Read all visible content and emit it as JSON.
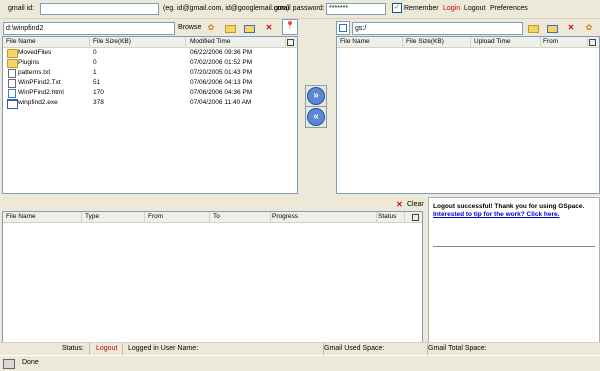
{
  "login": {
    "gmail_id_label": "gmail id:",
    "gmail_id_value": "",
    "gmail_id_hint": "(eg. id@gmail.com, id@googlemail.com)",
    "password_label": "gmail password:",
    "password_value": "*******",
    "remember_label": "Remember",
    "remember_checked": "✓",
    "login_link": "Login",
    "logout_link": "Logout",
    "preferences_link": "Preferences"
  },
  "local": {
    "path": "d:\\winpfind2",
    "browse_label": "Browse",
    "columns": [
      "File Name",
      "File Size(KB)",
      "Modified Time"
    ],
    "files": [
      {
        "name": "MovedFiles",
        "size": "0",
        "time": "06/22/2006 09:36 PM",
        "icon": "folder-icon"
      },
      {
        "name": "Plugins",
        "size": "0",
        "time": "07/02/2006 01:52 PM",
        "icon": "folder-icon"
      },
      {
        "name": "patterns.txt",
        "size": "1",
        "time": "07/20/2005 01:43 PM",
        "icon": "text-file-icon"
      },
      {
        "name": "WinPFind2.Txt",
        "size": "51",
        "time": "07/06/2006 04:13 PM",
        "icon": "text-file-icon"
      },
      {
        "name": "WinPFind2.html",
        "size": "170",
        "time": "07/06/2006 04:36 PM",
        "icon": "html-file-icon"
      },
      {
        "name": "winpfind2.exe",
        "size": "378",
        "time": "07/04/2006 11:40 AM",
        "icon": "exe-file-icon"
      }
    ]
  },
  "remote": {
    "path": "gs:/",
    "columns": [
      "File Name",
      "File Size(KB)",
      "Upload Time",
      "From"
    ]
  },
  "transfer": {
    "clear_label": "Clear",
    "columns": [
      "File Name",
      "Type",
      "From",
      "To",
      "Progress",
      "Status"
    ]
  },
  "messages": {
    "line1": "Logout successful! Thank you for using GSpace.",
    "line2": "Interested to tip for the work? Click here."
  },
  "status": {
    "status_label": "Status:",
    "status_value": "Logout",
    "logged_in_label": "Logged in User Name:",
    "used_space_label": "Gmail Used Space:",
    "total_space_label": "Gmail Total Space:",
    "done_text": "Done"
  }
}
